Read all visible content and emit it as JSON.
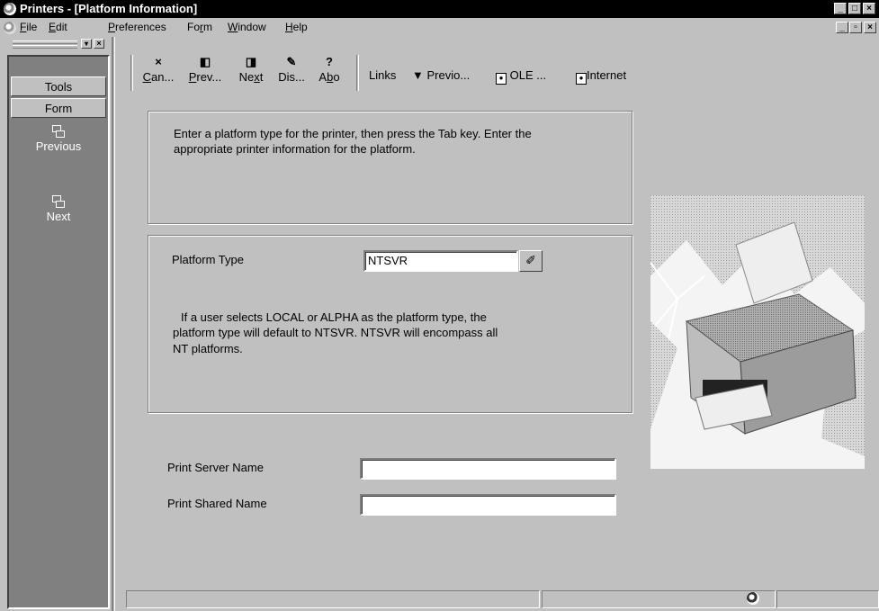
{
  "window": {
    "title": "Printers - [Platform Information]",
    "controls": {
      "minimize": "_",
      "maximize": "□",
      "close": "×"
    }
  },
  "menubar": {
    "items": [
      {
        "label": "File",
        "key": "F",
        "rest": "ile"
      },
      {
        "label": "Edit",
        "key": "E",
        "rest": "dit"
      },
      {
        "label": "Preferences",
        "key": "P",
        "rest": "references"
      },
      {
        "label": "Form",
        "pre": "Fo",
        "key": "r",
        "rest": "m"
      },
      {
        "label": "Window",
        "key": "W",
        "rest": "indow"
      },
      {
        "label": "Help",
        "key": "H",
        "rest": "elp"
      }
    ],
    "mdi_controls": {
      "minimize": "_",
      "restore": "▫",
      "close": "×"
    }
  },
  "left_panel": {
    "tabs": {
      "tools": "Tools",
      "form": "Form"
    },
    "buttons": {
      "previous": "Previous",
      "next": "Next"
    }
  },
  "toolbar": {
    "cancel": {
      "pre": "",
      "key": "C",
      "rest": "an...",
      "icon": "×"
    },
    "previous": {
      "pre": "",
      "key": "P",
      "rest": "rev...",
      "icon": "◧"
    },
    "next": {
      "pre": "Ne",
      "key": "x",
      "rest": "t",
      "icon": "◨"
    },
    "display": {
      "label": "Dis...",
      "icon": "✎"
    },
    "about": {
      "pre": "A",
      "key": "b",
      "rest": "o",
      "icon": "?"
    },
    "links": "Links",
    "previo": "Previo...",
    "ole": "OLE ...",
    "internet": "Internet"
  },
  "instructions": {
    "line1": "Enter a platform type for the printer, then press the Tab key.  Enter the",
    "line2": "appropriate printer information for the platform."
  },
  "platform": {
    "label": "Platform Type",
    "value": "NTSVR",
    "note_line1": "If a user selects LOCAL or ALPHA as the platform type, the",
    "note_line2": "platform type will default to NTSVR.  NTSVR will encompass all",
    "note_line3": "NT platforms."
  },
  "fields": {
    "print_server_name_label": "Print Server Name",
    "print_server_name_value": "",
    "print_shared_name_label": "Print Shared Name",
    "print_shared_name_value": ""
  }
}
